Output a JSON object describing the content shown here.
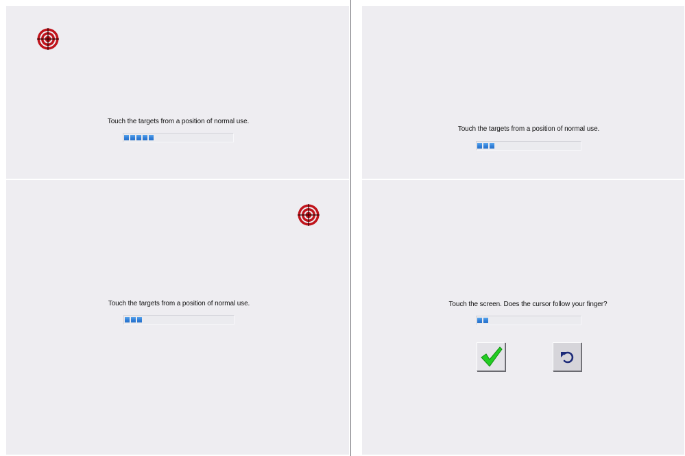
{
  "screens": [
    {
      "prompt": "Touch the targets from a position of normal use.",
      "progress_segments": 5,
      "target_icon": "crosshair-target-icon"
    },
    {
      "prompt": "Touch the targets from a position of normal use.",
      "progress_segments": 3,
      "target_icon": "crosshair-target-icon"
    },
    {
      "prompt": "Touch the targets from a position of normal use.",
      "progress_segments": 3
    },
    {
      "prompt": "Touch the screen. Does the cursor follow your finger?",
      "progress_segments": 2,
      "buttons": {
        "accept_icon": "checkmark-icon",
        "retry_icon": "undo-arrow-icon"
      }
    }
  ],
  "colors": {
    "background": "#eeedf1",
    "progress_fill": "#2f7ed8",
    "target_red": "#c0141c",
    "check_green": "#22cc22",
    "undo_blue": "#1c2a78"
  }
}
